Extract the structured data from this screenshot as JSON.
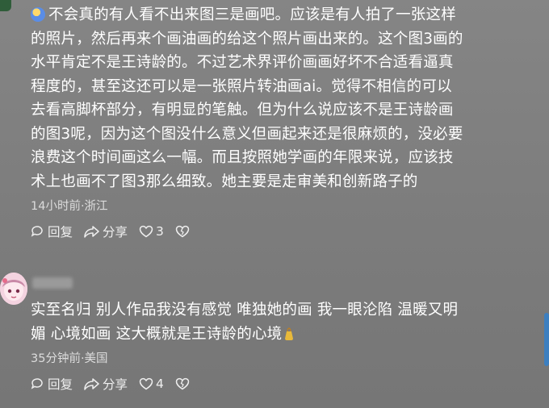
{
  "comments": [
    {
      "lines": [
        "不会真的有人看不出来图三是画吧。应该是有人拍了一张这样",
        "的照片，然后再来个画油画的给这个照片画出来的。这个图3画的",
        "水平肯定不是王诗龄的。不过艺术界评价画画好坏不合适看逼真",
        "程度的，甚至这还可以是一张照片转油画ai。觉得不相信的可以",
        "去看高脚杯部分，有明显的笔触。但为什么说应该不是王诗龄画",
        "的图3呢，因为这个图没什么意义但画起来还是很麻烦的，没必要",
        "浪费这个时间画这么一幅。而且按照她学画的年限来说，应该技",
        "术上也画不了图3那么细致。她主要是走审美和创新路子的"
      ],
      "meta": "14小时前·浙江",
      "reply_label": "回复",
      "share_label": "分享",
      "like_count": "3"
    },
    {
      "lines": [
        "实至名归 别人作品我没有感觉 唯独她的画 我一眼沦陷 温暖又明",
        "媚 心境如画 这大概就是王诗龄的心境"
      ],
      "meta": "35分钟前·美国",
      "reply_label": "回复",
      "share_label": "分享",
      "like_count": "4"
    }
  ],
  "colors": {
    "background": "#7d7d7d",
    "scrollbar": "#3d7fbf"
  }
}
